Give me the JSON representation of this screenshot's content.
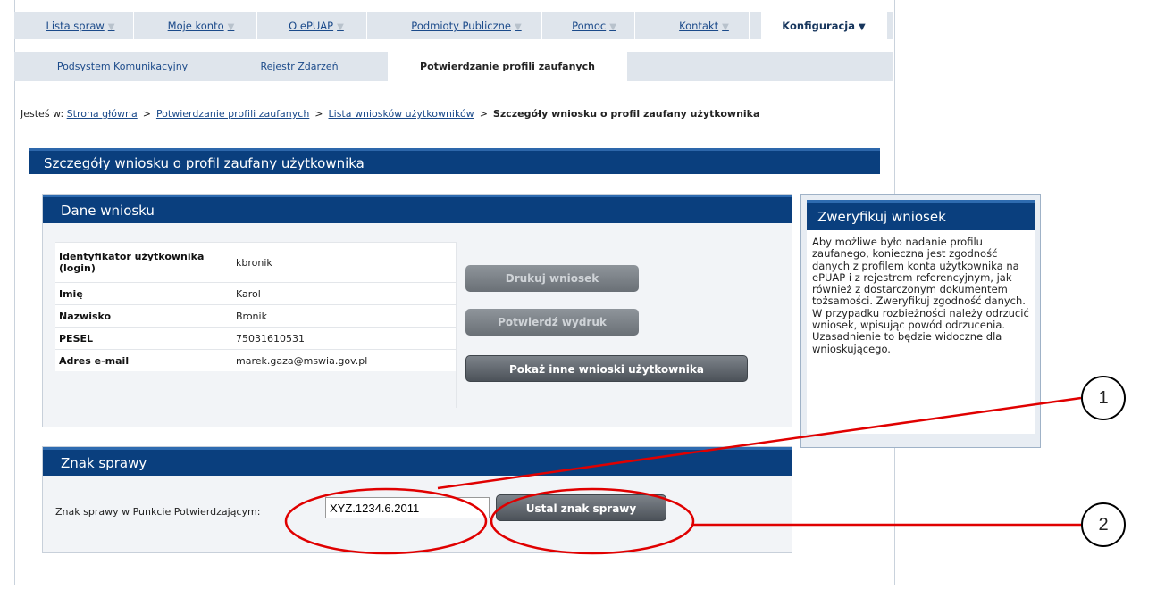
{
  "nav": {
    "main_tabs": [
      {
        "label": "Lista spraw"
      },
      {
        "label": "Moje konto"
      },
      {
        "label": "O ePUAP"
      },
      {
        "label": "Podmioty Publiczne"
      },
      {
        "label": "Pomoc"
      },
      {
        "label": "Kontakt"
      },
      {
        "label": "Konfiguracja"
      }
    ],
    "sub_tabs": [
      {
        "label": "Podsystem Komunikacyjny"
      },
      {
        "label": "Rejestr Zdarzeń"
      },
      {
        "label": "Potwierdzanie profili zaufanych"
      }
    ]
  },
  "breadcrumb": {
    "prefix": "Jesteś w:",
    "items": [
      "Strona główna",
      "Potwierdzanie profili zaufanych",
      "Lista wniosków użytkowników"
    ],
    "current": "Szczegóły wniosku o profil zaufany użytkownika",
    "separator": ">"
  },
  "page_title": "Szczegóły wniosku o profil zaufany użytkownika",
  "dane_wniosku": {
    "title": "Dane wniosku",
    "rows": [
      {
        "label": "Identyfikator użytkownika (login)",
        "value": "kbronik"
      },
      {
        "label": "Imię",
        "value": "Karol"
      },
      {
        "label": "Nazwisko",
        "value": "Bronik"
      },
      {
        "label": "PESEL",
        "value": "75031610531"
      },
      {
        "label": "Adres e-mail",
        "value": "marek.gaza@mswia.gov.pl"
      }
    ],
    "buttons": {
      "print": "Drukuj wniosek",
      "confirm_print": "Potwierdź wydruk",
      "show_other": "Pokaż inne wnioski użytkownika"
    }
  },
  "sidebar": {
    "title": "Zweryfikuj wniosek",
    "text": "Aby możliwe było nadanie profilu zaufanego, konieczna jest zgodność danych z profilem konta użytkownika na ePUAP i z rejestrem referencyjnym, jak również z dostarczonym dokumentem tożsamości. Zweryfikuj zgodność danych. W przypadku rozbieżności należy odrzucić wniosek, wpisując powód odrzucenia. Uzasadnienie to będzie widoczne dla wnioskującego."
  },
  "znak_sprawy": {
    "title": "Znak sprawy",
    "field_label": "Znak sprawy w Punkcie Potwierdzającym:",
    "field_value": "XYZ.1234.6.2011",
    "button": "Ustal znak sprawy"
  },
  "annotations": {
    "callout_1": "1",
    "callout_2": "2"
  },
  "colors": {
    "header_blue": "#0a3f7e",
    "link_blue": "#1b4a8a",
    "annotation_red": "#e00000",
    "nav_bg": "#dfe5ec"
  }
}
